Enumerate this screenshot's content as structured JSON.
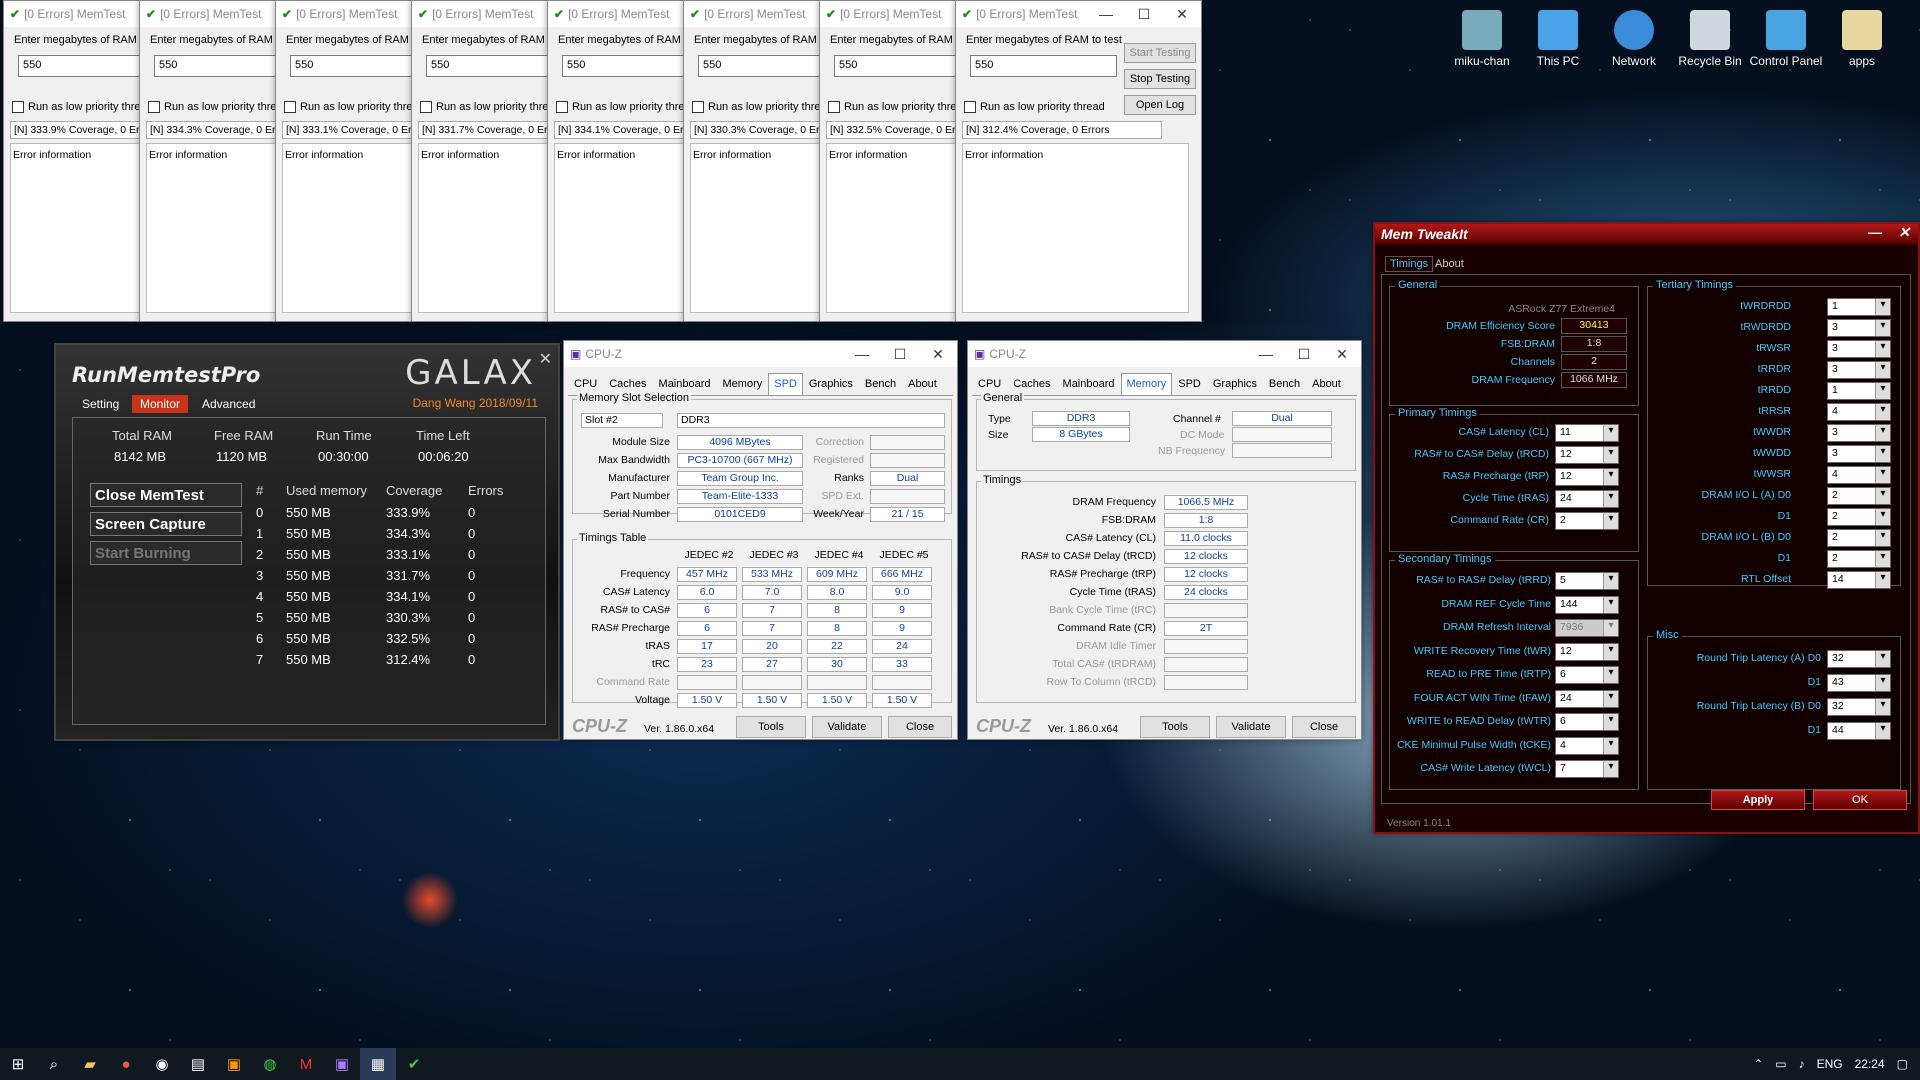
{
  "memtest": {
    "title": "[0 Errors] MemTest",
    "label": "Enter megabytes of RAM to test",
    "value": "550",
    "low_priority": "Run as low priority thread",
    "err_label": "Error information",
    "start": "Start Testing",
    "stop": "Stop Testing",
    "openlog": "Open Log",
    "status": [
      "[N]  333.9% Coverage, 0 Errors",
      "[N]  334.3% Coverage, 0 Errors",
      "[N]  333.1% Coverage, 0 Errors",
      "[N]  331.7% Coverage, 0 Errors",
      "[N]  334.1% Coverage, 0 Errors",
      "[N]  330.3% Coverage, 0 Errors",
      "[N]  332.5% Coverage, 0 Errors",
      "[N]  312.4% Coverage, 0 Errors"
    ]
  },
  "rmp": {
    "title": "RunMemtestPro",
    "brand": "GALAX",
    "tabs": [
      "Setting",
      "Monitor",
      "Advanced"
    ],
    "author": "Dang Wang 2018/09/11",
    "headers": [
      "Total RAM",
      "Free RAM",
      "Run Time",
      "Time Left"
    ],
    "values": [
      "8142 MB",
      "1120 MB",
      "00:30:00",
      "00:06:20"
    ],
    "btn_close": "Close MemTest",
    "btn_capture": "Screen Capture",
    "btn_burn": "Start Burning",
    "cols": [
      "#",
      "Used memory",
      "Coverage",
      "Errors"
    ],
    "rows": [
      [
        "0",
        "550 MB",
        "333.9%",
        "0"
      ],
      [
        "1",
        "550 MB",
        "334.3%",
        "0"
      ],
      [
        "2",
        "550 MB",
        "333.1%",
        "0"
      ],
      [
        "3",
        "550 MB",
        "331.7%",
        "0"
      ],
      [
        "4",
        "550 MB",
        "334.1%",
        "0"
      ],
      [
        "5",
        "550 MB",
        "330.3%",
        "0"
      ],
      [
        "6",
        "550 MB",
        "332.5%",
        "0"
      ],
      [
        "7",
        "550 MB",
        "312.4%",
        "0"
      ]
    ]
  },
  "cpuz": {
    "title": "CPU-Z",
    "tabs": [
      "CPU",
      "Caches",
      "Mainboard",
      "Memory",
      "SPD",
      "Graphics",
      "Bench",
      "About"
    ],
    "ver": "Ver. 1.86.0.x64",
    "tools": "Tools",
    "validate": "Validate",
    "close": "Close",
    "logo": "CPU-Z",
    "spd": {
      "grp1": "Memory Slot Selection",
      "slot": "Slot #2",
      "type": "DDR3",
      "module_size": "4096 MBytes",
      "max_bw": "PC3-10700 (667 MHz)",
      "manuf": "Team Group Inc.",
      "part": "Team-Elite-1333",
      "serial": "0101CED9",
      "ranks": "Dual",
      "week": "21 / 15",
      "labels": [
        "Module Size",
        "Max Bandwidth",
        "Manufacturer",
        "Part Number",
        "Serial Number"
      ],
      "rlabels": [
        "Correction",
        "Registered",
        "Ranks",
        "SPD Ext.",
        "Week/Year"
      ],
      "grp2": "Timings Table",
      "jedec": [
        "JEDEC #2",
        "JEDEC #3",
        "JEDEC #4",
        "JEDEC #5"
      ],
      "tlabels": [
        "Frequency",
        "CAS# Latency",
        "RAS# to CAS#",
        "RAS# Precharge",
        "tRAS",
        "tRC",
        "Command Rate",
        "Voltage"
      ],
      "tvals": [
        [
          "457 MHz",
          "533 MHz",
          "609 MHz",
          "666 MHz"
        ],
        [
          "6.0",
          "7.0",
          "8.0",
          "9.0"
        ],
        [
          "6",
          "7",
          "8",
          "9"
        ],
        [
          "6",
          "7",
          "8",
          "9"
        ],
        [
          "17",
          "20",
          "22",
          "24"
        ],
        [
          "23",
          "27",
          "30",
          "33"
        ],
        [
          "",
          "",
          "",
          ""
        ],
        [
          "1.50 V",
          "1.50 V",
          "1.50 V",
          "1.50 V"
        ]
      ]
    },
    "mem": {
      "grp1": "General",
      "type_l": "Type",
      "type": "DDR3",
      "size_l": "Size",
      "size": "8 GBytes",
      "ch_l": "Channel #",
      "ch": "Dual",
      "dc": "DC Mode",
      "nb": "NB Frequency",
      "grp2": "Timings",
      "labels": [
        "DRAM Frequency",
        "FSB:DRAM",
        "CAS# Latency (CL)",
        "RAS# to CAS# Delay (tRCD)",
        "RAS# Precharge (tRP)",
        "Cycle Time (tRAS)",
        "Bank Cycle Time (tRC)",
        "Command Rate (CR)",
        "DRAM Idle Timer",
        "Total CAS# (tRDRAM)",
        "Row To Column (tRCD)"
      ],
      "vals": [
        "1066.5 MHz",
        "1:8",
        "11.0 clocks",
        "12 clocks",
        "12 clocks",
        "24 clocks",
        "",
        "2T",
        "",
        "",
        ""
      ]
    }
  },
  "mt": {
    "title": "Mem TweakIt",
    "tabs": [
      "Timings",
      "About"
    ],
    "general": "General",
    "board": "ASRock Z77 Extreme4",
    "gen_labels": [
      "DRAM Efficiency Score",
      "FSB:DRAM",
      "Channels",
      "DRAM Frequency"
    ],
    "gen_vals": [
      "30413",
      "1:8",
      "2",
      "1066 MHz"
    ],
    "primary": "Primary Timings",
    "p_labels": [
      "CAS# Latency (CL)",
      "RAS# to CAS# Delay (tRCD)",
      "RAS# Precharge (tRP)",
      "Cycle Time (tRAS)",
      "Command Rate (CR)"
    ],
    "p_vals": [
      "11",
      "12",
      "12",
      "24",
      "2"
    ],
    "secondary": "Secondary Timings",
    "s_labels": [
      "RAS# to RAS# Delay (tRRD)",
      "DRAM REF Cycle Time",
      "DRAM Refresh Interval",
      "WRITE Recovery Time (tWR)",
      "READ to PRE Time (tRTP)",
      "FOUR ACT WIN Time (tFAW)",
      "WRITE to READ Delay (tWTR)",
      "CKE Minimul Pulse Width (tCKE)",
      "CAS# Write Latency (tWCL)"
    ],
    "s_vals": [
      "5",
      "144",
      "7936",
      "12",
      "6",
      "24",
      "6",
      "4",
      "7"
    ],
    "tertiary": "Tertiary Timings",
    "t_labels": [
      "tWRDRDD",
      "tRWDRDD",
      "tRWSR",
      "tRRDR",
      "tRRDD",
      "tRRSR",
      "tWWDR",
      "tWWDD",
      "tWWSR",
      "DRAM I/O L (A)  D0",
      "D1",
      "DRAM I/O L (B)  D0",
      "D1",
      "RTL Offset"
    ],
    "t_vals": [
      "1",
      "3",
      "3",
      "3",
      "1",
      "4",
      "3",
      "3",
      "4",
      "2",
      "2",
      "2",
      "2",
      "14"
    ],
    "misc": "Misc",
    "m_labels": [
      "Round Trip Latency (A)  D0",
      "D1",
      "Round Trip Latency (B)  D0",
      "D1"
    ],
    "m_vals": [
      "32",
      "43",
      "32",
      "44"
    ],
    "apply": "Apply",
    "ok": "OK",
    "version": "Version 1.01.1"
  },
  "desktop": [
    "miku-chan",
    "This PC",
    "Network",
    "Recycle Bin",
    "Control Panel",
    "apps"
  ],
  "taskbar": {
    "time": "22:24",
    "lang": "ENG"
  }
}
